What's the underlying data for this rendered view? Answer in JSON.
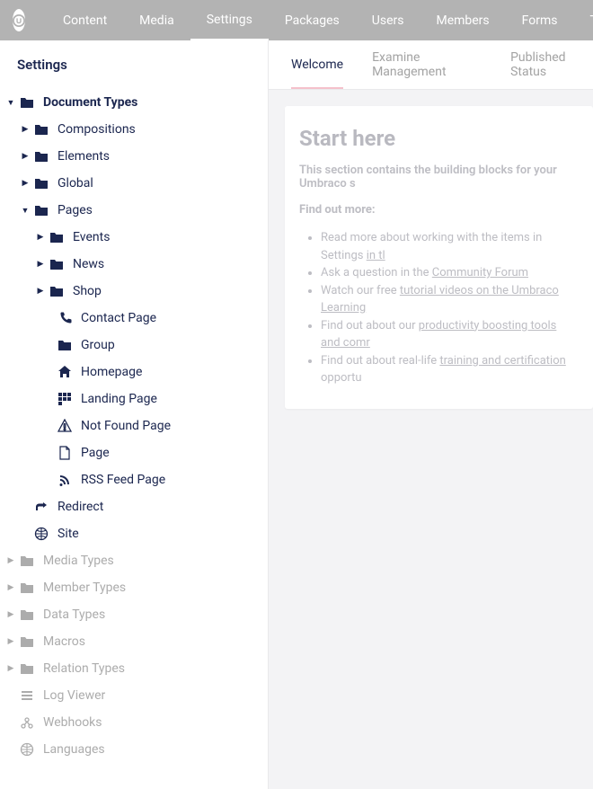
{
  "topnav": {
    "items": [
      "Content",
      "Media",
      "Settings",
      "Packages",
      "Users",
      "Members",
      "Forms",
      "Translation"
    ],
    "activeIndex": 2
  },
  "sidebar": {
    "title": "Settings",
    "tree": {
      "docTypes": "Document Types",
      "compositions": "Compositions",
      "elements": "Elements",
      "global": "Global",
      "pages": "Pages",
      "events": "Events",
      "news": "News",
      "shop": "Shop",
      "contactPage": "Contact Page",
      "group": "Group",
      "homepage": "Homepage",
      "landingPage": "Landing Page",
      "notFoundPage": "Not Found Page",
      "page": "Page",
      "rssFeedPage": "RSS Feed Page",
      "redirect": "Redirect",
      "site": "Site",
      "mediaTypes": "Media Types",
      "memberTypes": "Member Types",
      "dataTypes": "Data Types",
      "macros": "Macros",
      "relationTypes": "Relation Types",
      "logViewer": "Log Viewer",
      "webhooks": "Webhooks",
      "languages": "Languages"
    }
  },
  "tabs": {
    "items": [
      "Welcome",
      "Examine Management",
      "Published Status"
    ],
    "activeIndex": 0
  },
  "welcome": {
    "heading": "Start here",
    "intro": "This section contains the building blocks for your Umbraco s",
    "findOutMore": "Find out more:",
    "bullets": {
      "b1a": "Read more about working with the items in Settings ",
      "b1link": "in tl",
      "b2a": "Ask a question in the ",
      "b2link": "Community Forum",
      "b3a": "Watch our free ",
      "b3link": "tutorial videos on the Umbraco Learning",
      "b4a": "Find out about our ",
      "b4link": "productivity boosting tools and comr",
      "b5a": "Find out about real-life ",
      "b5link": "training and certification",
      "b5b": " opportu"
    }
  }
}
